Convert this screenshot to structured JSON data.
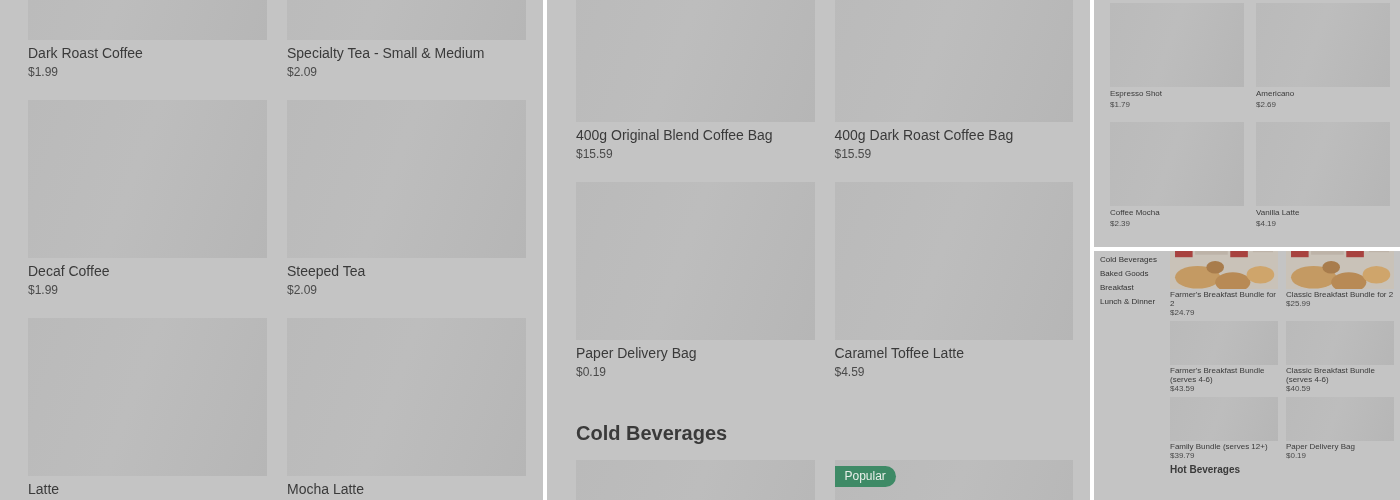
{
  "panels": [
    {
      "blocks": [
        {
          "kind": "grid",
          "items": [
            {
              "name": "Dark Roast Coffee",
              "price": "$1.99",
              "kind": "placeholder"
            },
            {
              "name": "Specialty Tea - Small & Medium",
              "price": "$2.09",
              "kind": "placeholder"
            },
            {
              "name": "Decaf Coffee",
              "price": "$1.99",
              "kind": "placeholder"
            },
            {
              "name": "Steeped Tea",
              "price": "$2.09",
              "kind": "placeholder"
            },
            {
              "name": "Latte",
              "kind": "placeholder"
            },
            {
              "name": "Mocha Latte",
              "kind": "placeholder"
            }
          ]
        }
      ]
    },
    {
      "blocks": [
        {
          "kind": "grid",
          "items": [
            {
              "name": "400g Original Blend Coffee Bag",
              "price": "$15.59",
              "kind": "placeholder"
            },
            {
              "name": "400g Dark Roast Coffee Bag",
              "price": "$15.59",
              "kind": "placeholder"
            },
            {
              "name": "Paper Delivery Bag",
              "price": "$0.19",
              "kind": "placeholder"
            },
            {
              "name": "Caramel Toffee Latte",
              "price": "$4.59",
              "kind": "placeholder"
            }
          ]
        },
        {
          "kind": "heading",
          "text": "Cold Beverages"
        },
        {
          "kind": "grid",
          "items": [
            {
              "kind": "placeholder"
            },
            {
              "kind": "placeholder",
              "badge": "Popular"
            }
          ]
        }
      ]
    },
    {
      "blocks": [
        {
          "kind": "grid",
          "items": [
            {
              "name": "Espresso Shot",
              "price": "$1.79",
              "kind": "placeholder"
            },
            {
              "name": "Americano",
              "price": "$2.69",
              "kind": "placeholder"
            },
            {
              "name": "Coffee Mocha",
              "price": "$2.39",
              "kind": "placeholder"
            },
            {
              "name": "Vanilla Latte",
              "price": "$4.19",
              "kind": "placeholder"
            }
          ]
        }
      ]
    },
    {
      "sidebar": [
        "Cold Beverages",
        "Baked Goods",
        "Breakfast",
        "Lunch & Dinner"
      ],
      "blocks": [
        {
          "kind": "grid",
          "items": [
            {
              "name": "Farmer's Breakfast Bundle for 2",
              "price": "$24.79",
              "kind": "picture"
            },
            {
              "name": "Classic Breakfast Bundle for 2",
              "price": "$25.99",
              "kind": "picture"
            },
            {
              "name": "Farmer's Breakfast Bundle (serves 4-6)",
              "price": "$43.59",
              "kind": "placeholder"
            },
            {
              "name": "Classic Breakfast Bundle (serves 4-6)",
              "price": "$40.59",
              "kind": "placeholder"
            },
            {
              "name": "Family Bundle (serves 12+)",
              "price": "$39.79",
              "kind": "placeholder"
            },
            {
              "name": "Paper Delivery Bag",
              "price": "$0.19",
              "kind": "placeholder"
            }
          ]
        },
        {
          "kind": "heading",
          "text": "Hot Beverages"
        }
      ]
    }
  ]
}
